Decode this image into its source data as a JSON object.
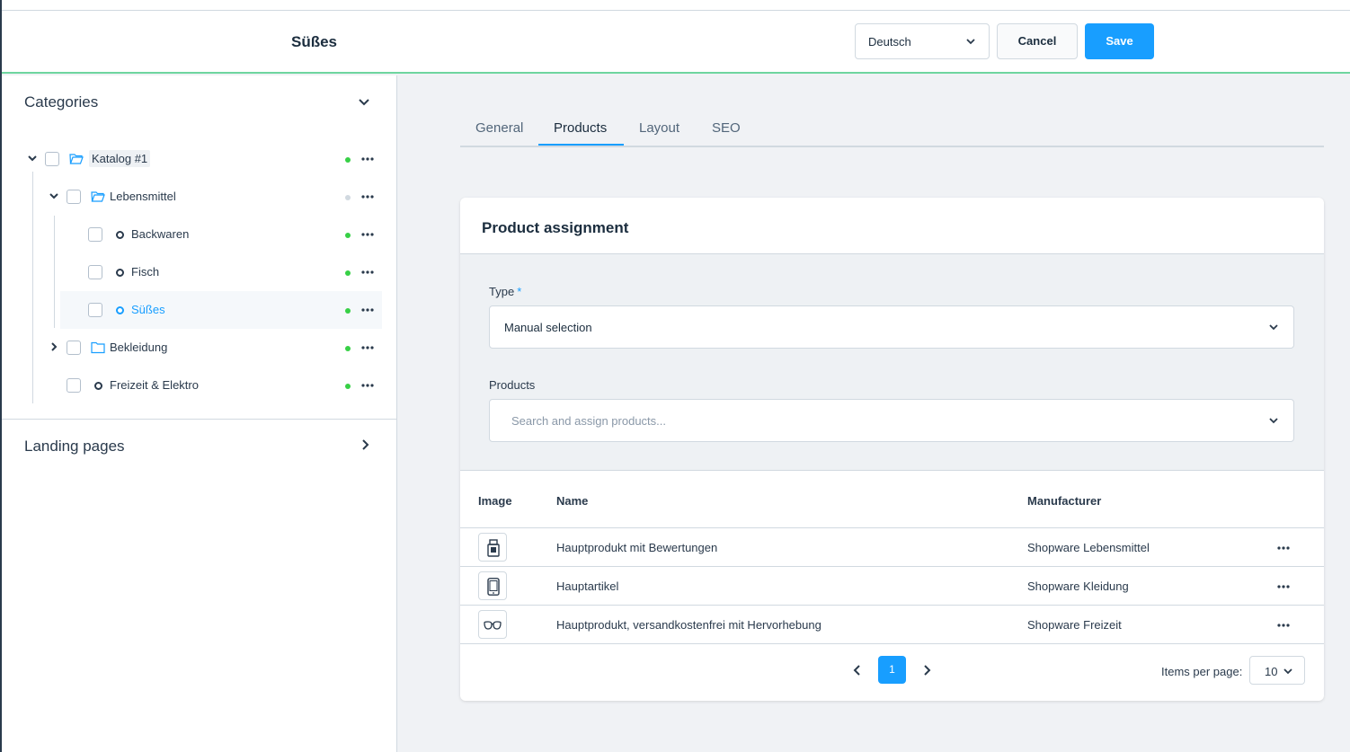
{
  "header": {
    "title": "Süßes",
    "language": "Deutsch",
    "cancel_label": "Cancel",
    "save_label": "Save"
  },
  "sidebar": {
    "categories_title": "Categories",
    "landing_pages_title": "Landing pages",
    "tree": [
      {
        "label": "Katalog #1",
        "type": "folder",
        "expanded": true,
        "active_status": true
      },
      {
        "label": "Lebensmittel",
        "type": "folder",
        "expanded": true,
        "active_status": false
      },
      {
        "label": "Backwaren",
        "type": "leaf",
        "active_status": true
      },
      {
        "label": "Fisch",
        "type": "leaf",
        "active_status": true
      },
      {
        "label": "Süßes",
        "type": "leaf",
        "selected": true,
        "active_status": true
      },
      {
        "label": "Bekleidung",
        "type": "folder",
        "expanded": false,
        "active_status": true
      },
      {
        "label": "Freizeit & Elektro",
        "type": "leaf",
        "active_status": true
      }
    ]
  },
  "tabs": [
    {
      "label": "General"
    },
    {
      "label": "Products",
      "active": true
    },
    {
      "label": "Layout"
    },
    {
      "label": "SEO"
    }
  ],
  "assignment": {
    "title": "Product assignment",
    "type_label": "Type",
    "required_mark": "*",
    "type_value": "Manual selection",
    "products_label": "Products",
    "products_placeholder": "Search and assign products..."
  },
  "grid": {
    "columns": [
      "Image",
      "Name",
      "Manufacturer"
    ],
    "rows": [
      {
        "image_icon": "bottle-icon",
        "name": "Hauptprodukt mit Bewertungen",
        "manufacturer": "Shopware Lebensmittel"
      },
      {
        "image_icon": "phone-icon",
        "name": "Hauptartikel",
        "manufacturer": "Shopware Kleidung"
      },
      {
        "image_icon": "glasses-icon",
        "name": "Hauptprodukt, versandkostenfrei mit Hervorhebung",
        "manufacturer": "Shopware Freizeit"
      }
    ]
  },
  "pagination": {
    "current_page": "1",
    "items_per_page_label": "Items per page:",
    "items_per_page": "10"
  },
  "colors": {
    "accent": "#189eff",
    "status_active": "#37d046",
    "header_border": "#6ed59f"
  }
}
